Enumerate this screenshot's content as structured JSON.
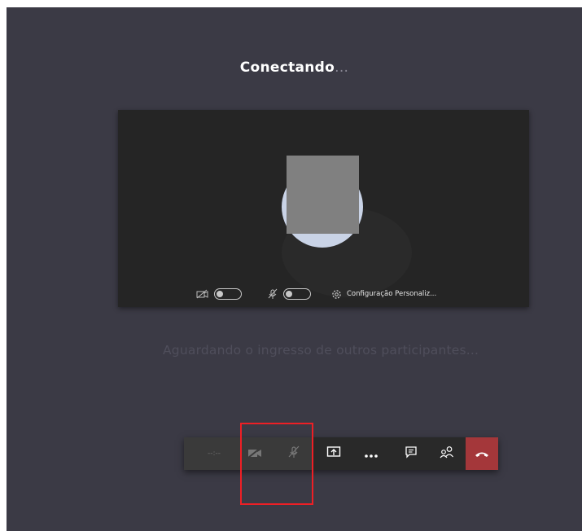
{
  "meeting": {
    "status_title": "Conectando",
    "status_dots": "..."
  },
  "preview": {
    "background_settings_label": "Configuração Personaliz...",
    "camera_toggle": "off",
    "mic_toggle": "off"
  },
  "waiting_message": "Aguardando o ingresso de outros participantes...",
  "toolbar": {
    "timer": "--:--",
    "items": [
      "camera-off-icon",
      "mic-off-icon",
      "share-screen-icon",
      "more-icon",
      "chat-icon",
      "participants-icon",
      "hang-up-icon"
    ]
  },
  "colors": {
    "stage_background": "#3b3a45",
    "preview_background": "#252525",
    "hangup": "#a4373a",
    "highlight": "#ee1f25"
  }
}
